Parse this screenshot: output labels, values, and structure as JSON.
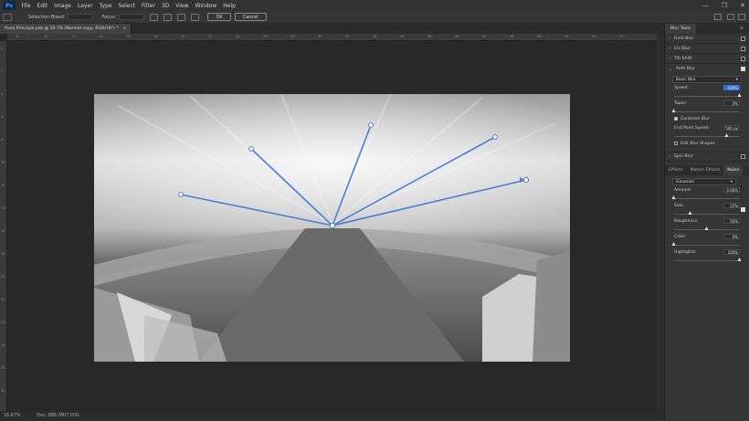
{
  "app": {
    "logo": "Ps"
  },
  "menu": [
    "File",
    "Edit",
    "Image",
    "Layer",
    "Type",
    "Select",
    "Filter",
    "3D",
    "View",
    "Window",
    "Help"
  ],
  "options_bar": {
    "selection_bleed_label": "Selection Bleed:",
    "focus_label": "Focus:",
    "ok_label": "OK",
    "cancel_label": "Cancel"
  },
  "document_tab": {
    "title": "Puno Principal.psb @ 16.7% (Normal copy, RGB/16*) *",
    "close": "×"
  },
  "ruler_top_labels": [
    "8",
    "10",
    "12",
    "14",
    "16",
    "18",
    "20",
    "22",
    "24",
    "26",
    "28",
    "30",
    "32",
    "34",
    "36",
    "38",
    "40",
    "42",
    "44",
    "46",
    "48",
    "50",
    "52"
  ],
  "ruler_left_labels": [
    "0",
    "2",
    "4",
    "6",
    "8",
    "10",
    "12",
    "14",
    "16",
    "18",
    "20",
    "22",
    "24",
    "26",
    "28",
    "30"
  ],
  "status": {
    "zoom": "16.67%",
    "doc": "Doc: 686.0M/7.00G"
  },
  "panel": {
    "title": "Blur Tools",
    "sections": [
      {
        "label": "Field Blur",
        "checked": false
      },
      {
        "label": "Iris Blur",
        "checked": false
      },
      {
        "label": "Tilt-Shift",
        "checked": false
      },
      {
        "label": "Path Blur",
        "checked": true
      }
    ],
    "path_blur": {
      "mode": "Basic Blur",
      "speed_label": "Speed:",
      "speed_value": "100%",
      "speed_fraction": 1.0,
      "taper_label": "Taper:",
      "taper_value": "0%",
      "taper_fraction": 0.0,
      "centered_blur_label": "Centered Blur",
      "centered_blur": true,
      "end_point_speed_label": "End Point Speed:",
      "end_point_speed_value": "504 px",
      "end_point_speed_fraction": 0.8,
      "edit_blur_shapes_label": "Edit Blur Shapes",
      "edit_blur_shapes": false
    },
    "spin_blur": {
      "label": "Spin Blur",
      "checked": false
    },
    "subtabs": [
      "Effects",
      "Motion Effects",
      "Noise"
    ],
    "active_subtab": "Noise",
    "noise": {
      "type": "Gaussian",
      "amount_label": "Amount:",
      "amount_value": "0.00%",
      "amount_fraction": 0.0,
      "size_label": "Size:",
      "size_value": "25%",
      "size_fraction": 0.25,
      "roughness_label": "Roughness:",
      "roughness_value": "50%",
      "roughness_fraction": 0.5,
      "color_label": "Color:",
      "color_value": "0%",
      "color_fraction": 0.0,
      "highlights_label": "Highlights:",
      "highlights_value": "100%",
      "highlights_fraction": 1.0
    }
  },
  "colors": {
    "accent": "#2f6fd6",
    "blur_path": "#4a7fd6"
  }
}
